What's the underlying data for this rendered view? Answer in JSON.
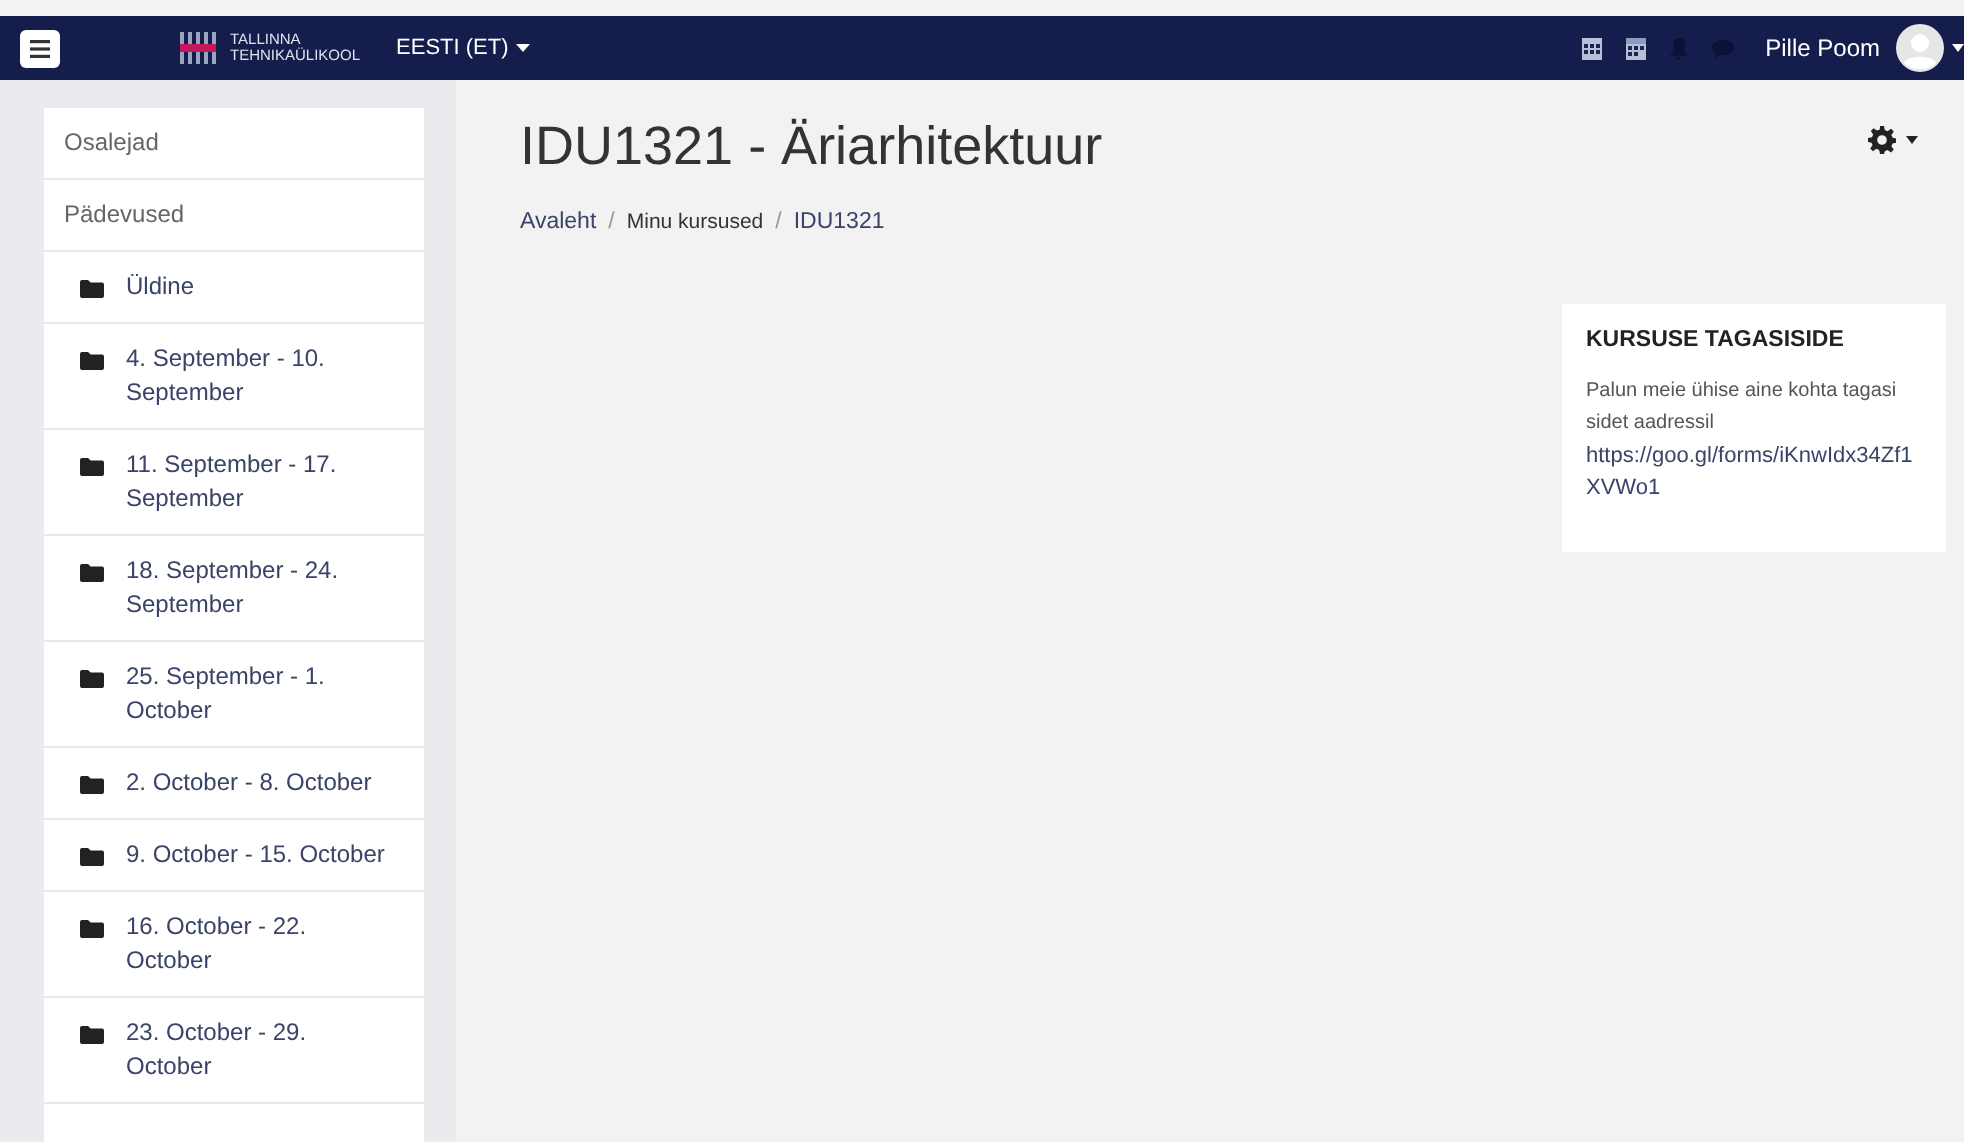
{
  "navbar": {
    "logo_line1": "TALLINNA",
    "logo_line2": "TEHNIKAÜLIKOOL",
    "language": "EESTI (ET)",
    "user_name": "Pille Poom"
  },
  "sidebar": {
    "items": [
      {
        "kind": "plain",
        "label": "Osalejad"
      },
      {
        "kind": "plain",
        "label": "Pädevused"
      },
      {
        "kind": "section",
        "label": "Üldine"
      },
      {
        "kind": "section",
        "label": "4. September - 10. September"
      },
      {
        "kind": "section",
        "label": "11. September - 17. September"
      },
      {
        "kind": "section",
        "label": "18. September - 24. September"
      },
      {
        "kind": "section",
        "label": "25. September - 1. October"
      },
      {
        "kind": "section",
        "label": "2. October - 8. October"
      },
      {
        "kind": "section",
        "label": "9. October - 15. October"
      },
      {
        "kind": "section",
        "label": "16. October - 22. October"
      },
      {
        "kind": "section",
        "label": "23. October - 29. October"
      }
    ]
  },
  "page": {
    "title": "IDU1321 - Äriarhitektuur",
    "breadcrumb_separator": "/",
    "breadcrumb": [
      {
        "label": "Avaleht",
        "kind": "link"
      },
      {
        "label": "Minu kursused",
        "kind": "text"
      },
      {
        "label": "IDU1321",
        "kind": "link"
      }
    ]
  },
  "block": {
    "title": "KURSUSE TAGASISIDE",
    "text": "Palun meie ühise aine kohta tagasi sidet aadressil",
    "link": "https://goo.gl/forms/iKnwIdx34Zf1XVWo1"
  }
}
